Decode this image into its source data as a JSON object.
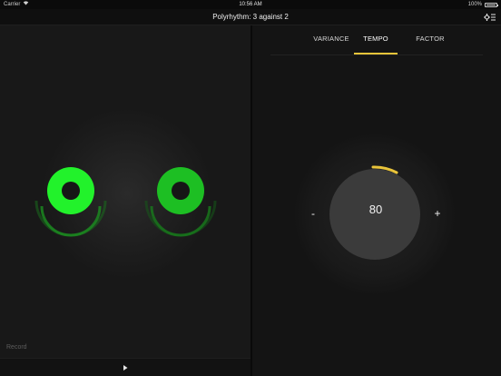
{
  "status_bar": {
    "carrier": "Carrier",
    "time": "10:56 AM",
    "battery": "100%",
    "battery_level": 1.0
  },
  "nav": {
    "title": "Polyrhythm: 3 against 2",
    "settings_icon": "settings-sliders-icon"
  },
  "left_panel": {
    "record_label": "Record",
    "play_icon": "play-icon",
    "circles": [
      {
        "name": "rhythm-3",
        "ring_color": "#22f22b",
        "glow_color": "#1f8f22"
      },
      {
        "name": "rhythm-2",
        "ring_color": "#1dbf23",
        "glow_color": "#1a7a1d"
      }
    ]
  },
  "right_panel": {
    "tabs": [
      {
        "label": "VARIANCE",
        "active": false
      },
      {
        "label": "TEMPO",
        "active": true
      },
      {
        "label": "FACTOR",
        "active": false
      }
    ],
    "tempo": {
      "value": "80",
      "minus_label": "-",
      "plus_label": "+"
    }
  },
  "colors": {
    "accent": "#e9c43a",
    "background": "#141414",
    "green_bright": "#22f22b",
    "green_mid": "#1dbf23"
  }
}
